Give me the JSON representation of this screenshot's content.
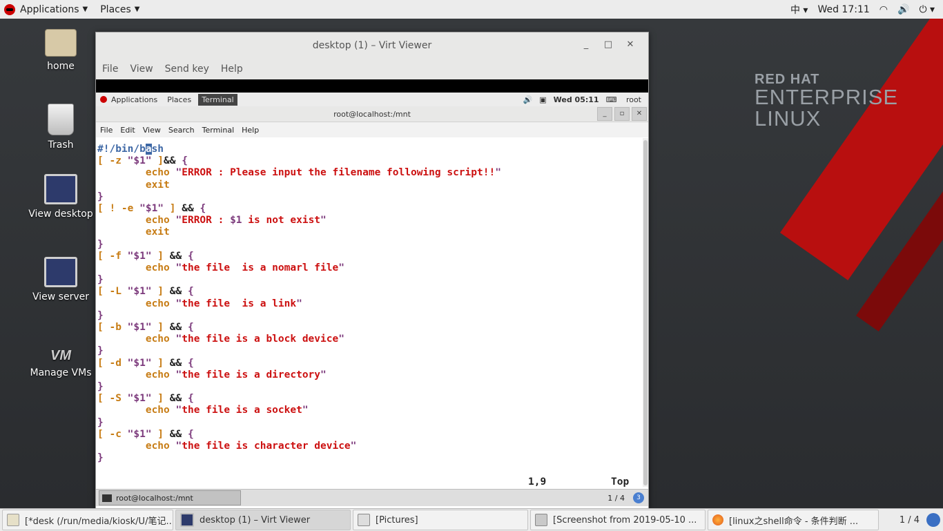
{
  "topbar": {
    "applications": "Applications",
    "places": "Places",
    "input_method": "中",
    "clock": "Wed 17:11"
  },
  "brand": {
    "line1": "RED HAT",
    "line2": "ENTERPRISE",
    "line3": "LINUX"
  },
  "desktop_icons": [
    {
      "label": "home"
    },
    {
      "label": "Trash"
    },
    {
      "label": "View desktop"
    },
    {
      "label": "View server"
    },
    {
      "label": "Manage VMs"
    }
  ],
  "virt_viewer": {
    "title": "desktop (1) – Virt Viewer",
    "menu": [
      "File",
      "View",
      "Send key",
      "Help"
    ]
  },
  "guest_panel": {
    "applications": "Applications",
    "places": "Places",
    "terminal": "Terminal",
    "clock": "Wed 05:11",
    "user": "root"
  },
  "terminal": {
    "title": "root@localhost:/mnt",
    "menu": [
      "File",
      "Edit",
      "View",
      "Search",
      "Terminal",
      "Help"
    ],
    "cursor_pos": "1,9",
    "scroll_pos": "Top"
  },
  "guest_taskbar": {
    "task": "root@localhost:/mnt",
    "page": "1 / 4"
  },
  "taskbar": {
    "items": [
      "[*desk (/run/media/kiosk/U/笔记...",
      "desktop (1) – Virt Viewer",
      "[Pictures]",
      "[Screenshot from 2019-05-10 ...",
      "[linux之shell命令 - 条件判断 ..."
    ],
    "page": "1 / 4"
  }
}
